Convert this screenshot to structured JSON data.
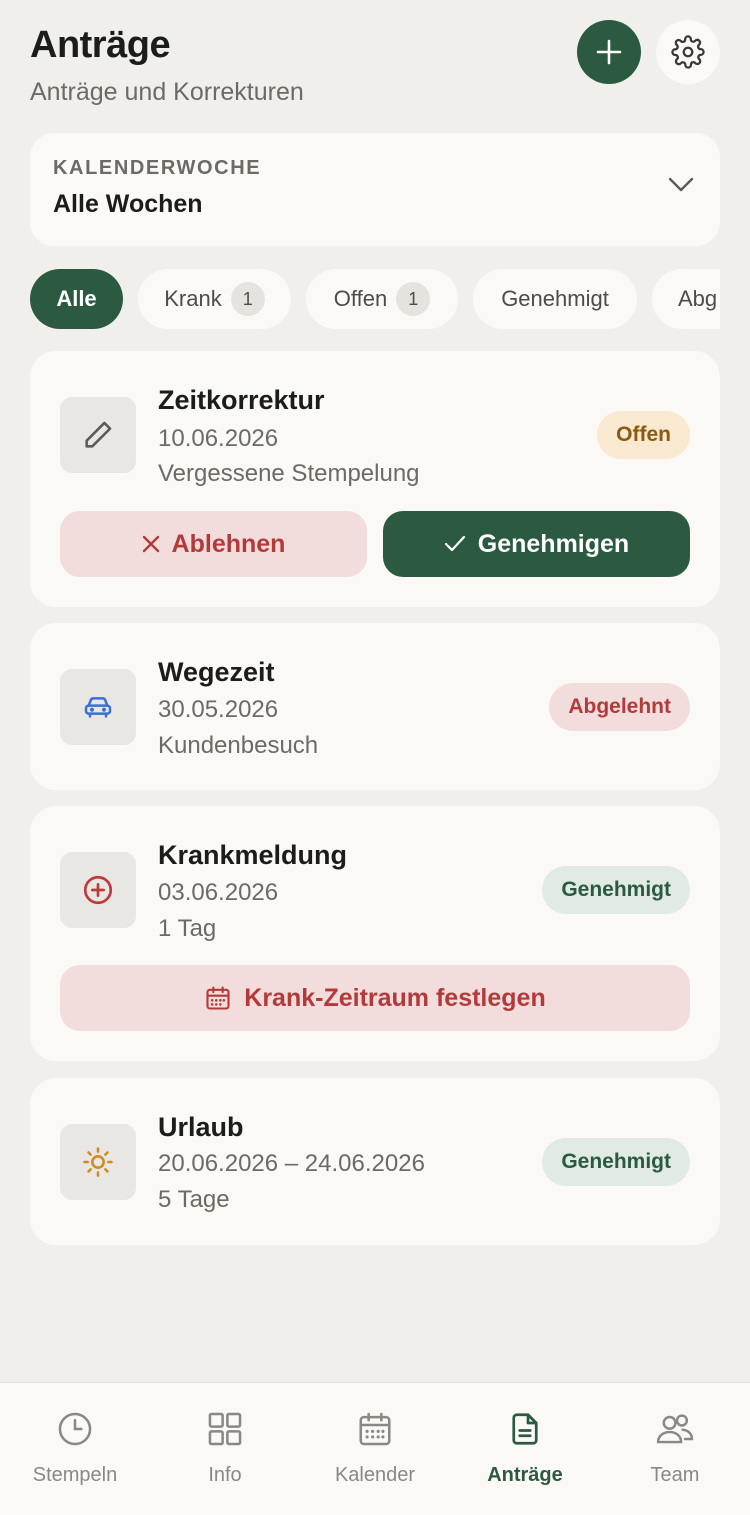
{
  "header": {
    "title": "Anträge",
    "subtitle": "Anträge und Korrekturen",
    "add_icon": "plus-icon",
    "settings_icon": "gear-icon"
  },
  "week_filter": {
    "label": "KALENDERWOCHE",
    "value": "Alle Wochen",
    "icon": "chevron-down-icon"
  },
  "filters": [
    {
      "label": "Alle",
      "active": true
    },
    {
      "label": "Krank",
      "count": "1"
    },
    {
      "label": "Offen",
      "count": "1"
    },
    {
      "label": "Genehmigt"
    },
    {
      "label": "Abg"
    }
  ],
  "requests": [
    {
      "title": "Zeitkorrektur",
      "date": "10.06.2026",
      "note": "Vergessene Stempelung",
      "status": "Offen",
      "icon": "pencil-icon",
      "actions": {
        "reject": "Ablehnen",
        "approve": "Genehmigen"
      }
    },
    {
      "title": "Wegezeit",
      "date": "30.05.2026",
      "note": "Kundenbesuch",
      "status": "Abgelehnt",
      "icon": "car-icon"
    },
    {
      "title": "Krankmeldung",
      "date": "03.06.2026",
      "note": "1 Tag",
      "status": "Genehmigt",
      "icon": "plus-circle-icon",
      "action": "Krank-Zeitraum festlegen"
    },
    {
      "title": "Urlaub",
      "date": "20.06.2026 – 24.06.2026",
      "note": "5 Tage",
      "status": "Genehmigt",
      "icon": "sun-icon"
    }
  ],
  "nav": [
    {
      "label": "Stempeln",
      "icon": "clock-icon"
    },
    {
      "label": "Info",
      "icon": "grid-icon"
    },
    {
      "label": "Kalender",
      "icon": "calendar-icon"
    },
    {
      "label": "Anträge",
      "icon": "document-icon",
      "active": true
    },
    {
      "label": "Team",
      "icon": "people-icon"
    }
  ],
  "colors": {
    "accent": "#2b5a41",
    "background": "#f1efeb",
    "card": "#faf9f6",
    "danger": "#b43a3a",
    "warning_text": "#8a5a12"
  }
}
